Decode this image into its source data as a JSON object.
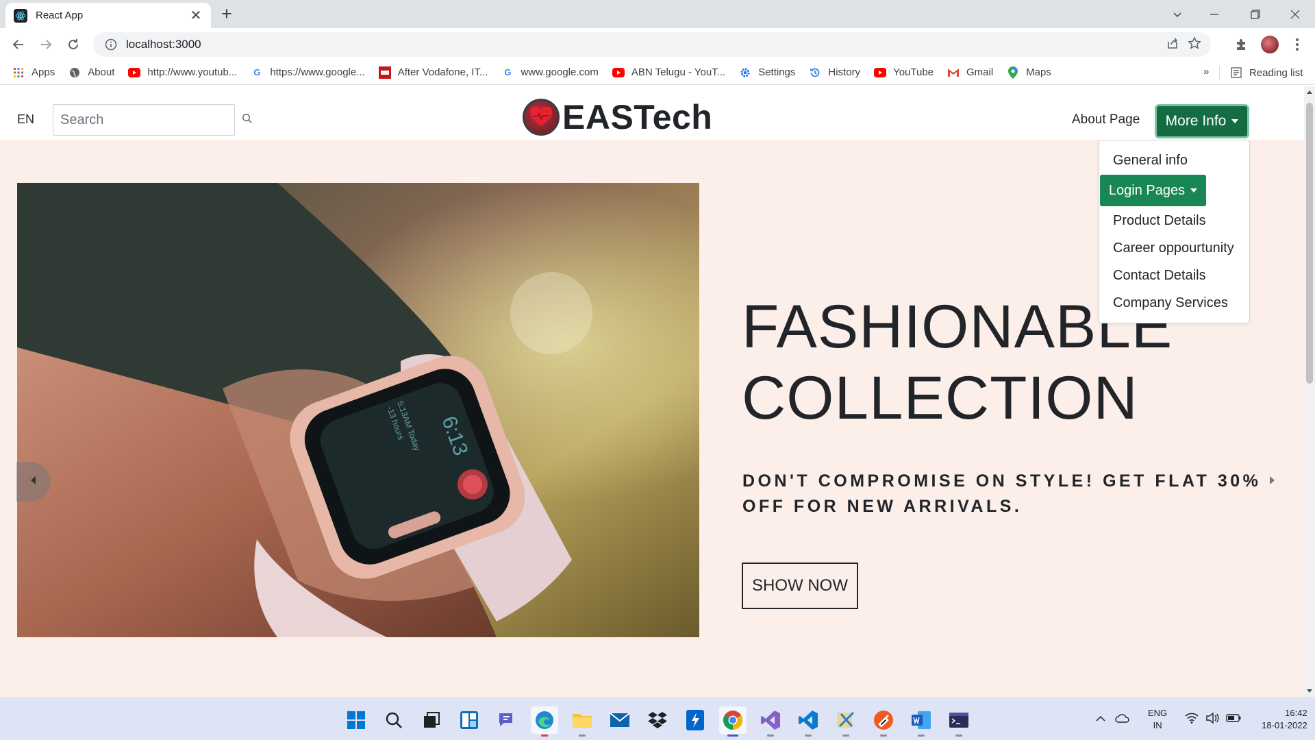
{
  "browser": {
    "tab_title": "React App",
    "new_tab_symbol": "+",
    "url": "localhost:3000",
    "bookmarks": [
      {
        "label": "Apps",
        "icon": "apps-grid-icon"
      },
      {
        "label": "About",
        "icon": "globe-icon"
      },
      {
        "label": "http://www.youtub...",
        "icon": "youtube-icon"
      },
      {
        "label": "https://www.google...",
        "icon": "google-icon"
      },
      {
        "label": "After Vodafone, IT...",
        "icon": "news-icon"
      },
      {
        "label": "www.google.com",
        "icon": "google-icon"
      },
      {
        "label": "ABN Telugu - YouT...",
        "icon": "youtube-icon"
      },
      {
        "label": "Settings",
        "icon": "gear-icon"
      },
      {
        "label": "History",
        "icon": "history-icon"
      },
      {
        "label": "YouTube",
        "icon": "youtube-icon"
      },
      {
        "label": "Gmail",
        "icon": "gmail-icon"
      },
      {
        "label": "Maps",
        "icon": "maps-pin-icon"
      }
    ],
    "bookmarks_overflow": "»",
    "reading_list": "Reading list"
  },
  "page": {
    "nav": {
      "lang": "EN",
      "search_placeholder": "Search",
      "brand": "EASTech",
      "about": "About Page",
      "more_info": "More Info"
    },
    "dropdown": {
      "general": "General info",
      "login": "Login Pages",
      "product": "Product Details",
      "career": "Career oppourtunity",
      "contact": "Contact Details",
      "services": "Company Services"
    },
    "hero": {
      "title_line1": "FASHIONABLE",
      "title_line2": "COLLECTION",
      "subtitle": "DON'T COMPROMISE ON STYLE! GET FLAT 30% OFF FOR NEW ARRIVALS.",
      "button": "SHOW NOW",
      "watch_time": "6:13",
      "watch_line1": "5:13AM Today",
      "watch_line2": "-13 hours"
    }
  },
  "taskbar": {
    "lang_line1": "ENG",
    "lang_line2": "IN",
    "time": "16:42",
    "date": "18-01-2022"
  },
  "colors": {
    "brand_green": "#198754",
    "hero_bg": "#fcefea",
    "chrome_frame": "#dee1e6",
    "taskbar_bg": "#dee4f5"
  }
}
